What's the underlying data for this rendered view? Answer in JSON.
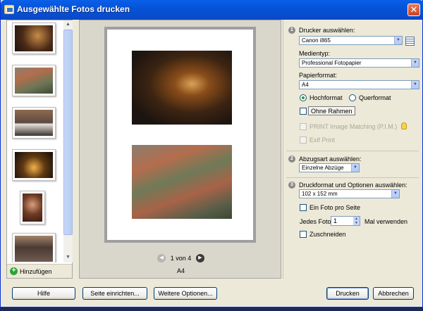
{
  "window": {
    "title": "Ausgewählte Fotos drucken"
  },
  "sidebar": {
    "add_label": "Hinzufügen"
  },
  "preview": {
    "page_indicator": "1 von 4",
    "paper_label": "A4"
  },
  "options": {
    "step1": {
      "number": "1",
      "printer_label": "Drucker auswählen:",
      "printer_value": "Canon i865",
      "media_label": "Medientyp:",
      "media_value": "Professional Fotopapier",
      "paper_label": "Papierformat:",
      "paper_value": "A4",
      "portrait": "Hochformat",
      "landscape": "Querformat",
      "borderless": "Ohne Rahmen",
      "pim": "PRINT Image Matching (P.I.M.)",
      "exif": "Exif Print"
    },
    "step2": {
      "number": "2",
      "label": "Abzugsart auswählen:",
      "value": "Einzelne Abzüge"
    },
    "step3": {
      "number": "3",
      "label": "Druckformat und Optionen auswählen:",
      "format_value": "102 x 152 mm",
      "one_per_page": "Ein Foto pro Seite",
      "each_photo": "Jedes Foto",
      "count_value": "1",
      "times_label": "Mal verwenden",
      "crop": "Zuschneiden"
    }
  },
  "buttons": {
    "help": "Hilfe",
    "page_setup": "Seite einrichten...",
    "more_options": "Weitere Optionen...",
    "print": "Drucken",
    "cancel": "Abbrechen"
  }
}
